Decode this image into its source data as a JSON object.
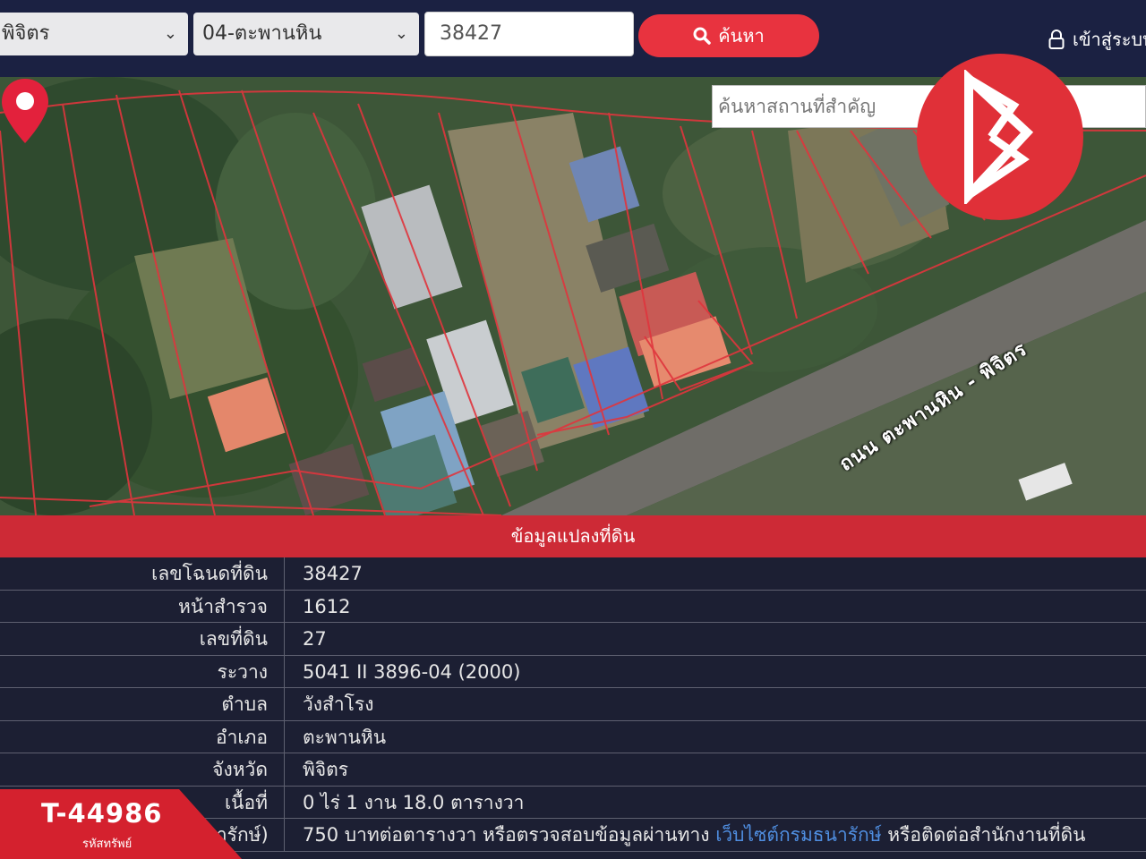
{
  "header": {
    "province": "พิจิตร",
    "district": "04-ตะพานหิน",
    "deed_value": "38427",
    "search_label": "ค้นหา",
    "login_label": "เข้าสู่ระบบ"
  },
  "map": {
    "search_placeholder": "ค้นหาสถานที่สำคัญ",
    "road_label": "ถนน ตะพานหิน - พิจิตร"
  },
  "info": {
    "title": "ข้อมูลแปลงที่ดิน",
    "rows": [
      {
        "label": "เลขโฉนดที่ดิน",
        "value": "38427"
      },
      {
        "label": "หน้าสำรวจ",
        "value": "1612"
      },
      {
        "label": "เลขที่ดิน",
        "value": "27"
      },
      {
        "label": "ระวาง",
        "value": "5041 II 3896-04 (2000)"
      },
      {
        "label": "ตำบล",
        "value": "วังสำโรง"
      },
      {
        "label": "อำเภอ",
        "value": "ตะพานหิน"
      },
      {
        "label": "จังหวัด",
        "value": "พิจิตร"
      },
      {
        "label": "เนื้อที่",
        "value": "0 ไร่ 1 งาน 18.0 ตารางวา"
      },
      {
        "label": "ราคาประเมินที่ดิน (กรมธนารักษ์)",
        "value": "750 บาทต่อตารางวา หรือตรวจสอบข้อมูลผ่านทาง",
        "link": "เว็บไซต์กรมธนารักษ์",
        "value_after": "หรือติดต่อสำนักงานที่ดิน"
      }
    ]
  },
  "badge": {
    "code": "T-44986",
    "subtitle": "รหัสทรัพย์"
  },
  "colors": {
    "navy": "#1b2142",
    "accent_red": "#e8333f",
    "table_bg": "#1c1f33",
    "link_blue": "#4f8ee0"
  }
}
